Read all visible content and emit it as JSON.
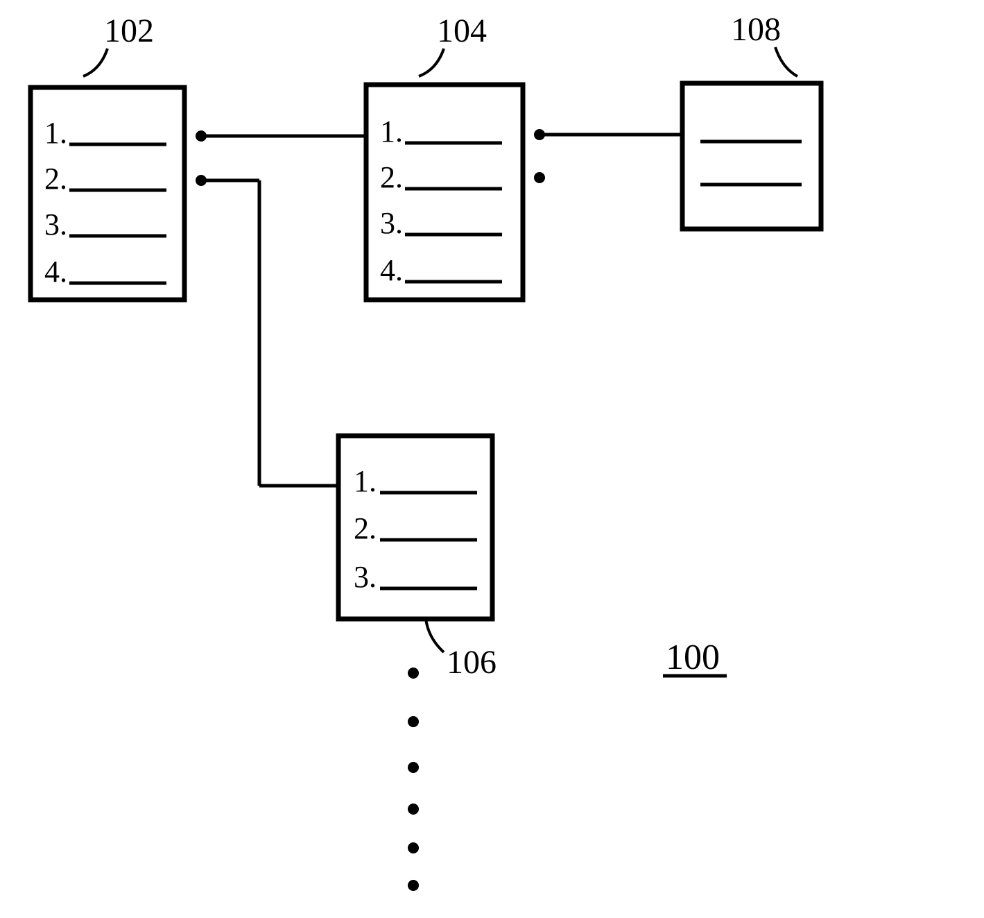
{
  "boxes": {
    "box102": {
      "label": "102",
      "items": [
        "1.",
        "2.",
        "3.",
        "4."
      ]
    },
    "box104": {
      "label": "104",
      "items": [
        "1.",
        "2.",
        "3.",
        "4."
      ]
    },
    "box106": {
      "label": "106",
      "items": [
        "1.",
        "2.",
        "3."
      ]
    },
    "box108": {
      "label": "108"
    }
  },
  "figure_label": "100"
}
